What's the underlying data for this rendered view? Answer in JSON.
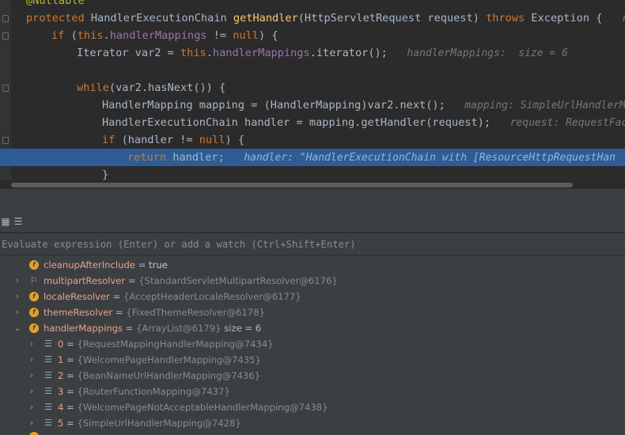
{
  "editor": {
    "lines": [
      {
        "indent": 0,
        "tokens": [
          {
            "t": "@Nullable",
            "c": "tok-anno"
          }
        ]
      },
      {
        "indent": 0,
        "fold": true,
        "tokens": [
          {
            "t": "protected ",
            "c": "tok-kw"
          },
          {
            "t": "HandlerExecutionChain ",
            "c": "tok-plain"
          },
          {
            "t": "getHandler",
            "c": "tok-method"
          },
          {
            "t": "(HttpServletRequest request) ",
            "c": "tok-plain"
          },
          {
            "t": "throws ",
            "c": "tok-kw"
          },
          {
            "t": "Exception {   ",
            "c": "tok-plain"
          },
          {
            "t": "re",
            "c": "hint"
          }
        ]
      },
      {
        "indent": 1,
        "fold": true,
        "tokens": [
          {
            "t": "if ",
            "c": "tok-kw"
          },
          {
            "t": "(",
            "c": "tok-plain"
          },
          {
            "t": "this",
            "c": "tok-kw"
          },
          {
            "t": ".",
            "c": "tok-plain"
          },
          {
            "t": "handlerMappings ",
            "c": "tok-field"
          },
          {
            "t": "!= ",
            "c": "tok-plain"
          },
          {
            "t": "null",
            "c": "tok-kw"
          },
          {
            "t": ") {",
            "c": "tok-plain"
          }
        ]
      },
      {
        "indent": 2,
        "tokens": [
          {
            "t": "Iterator var2 = ",
            "c": "tok-plain"
          },
          {
            "t": "this",
            "c": "tok-kw"
          },
          {
            "t": ".",
            "c": "tok-plain"
          },
          {
            "t": "handlerMappings",
            "c": "tok-field"
          },
          {
            "t": ".iterator();   ",
            "c": "tok-plain"
          },
          {
            "t": "handlerMappings:  size = 6",
            "c": "hint"
          }
        ]
      },
      {
        "indent": 0,
        "tokens": []
      },
      {
        "indent": 2,
        "fold": true,
        "tokens": [
          {
            "t": "while",
            "c": "tok-kw"
          },
          {
            "t": "(var2.hasNext()) {",
            "c": "tok-plain"
          }
        ]
      },
      {
        "indent": 3,
        "tokens": [
          {
            "t": "HandlerMapping mapping = (HandlerMapping)var2.next();   ",
            "c": "tok-plain"
          },
          {
            "t": "mapping: SimpleUrlHandlerM",
            "c": "hint"
          }
        ]
      },
      {
        "indent": 3,
        "tokens": [
          {
            "t": "HandlerExecutionChain handler = mapping.getHandler(request);   ",
            "c": "tok-plain"
          },
          {
            "t": "request: RequestFac",
            "c": "hint"
          }
        ]
      },
      {
        "indent": 3,
        "fold": true,
        "tokens": [
          {
            "t": "if ",
            "c": "tok-kw"
          },
          {
            "t": "(handler != ",
            "c": "tok-plain"
          },
          {
            "t": "null",
            "c": "tok-kw"
          },
          {
            "t": ") {",
            "c": "tok-plain"
          }
        ]
      },
      {
        "indent": 4,
        "active": true,
        "tokens": [
          {
            "t": "return ",
            "c": "tok-kw"
          },
          {
            "t": "handler;   ",
            "c": "tok-plain"
          },
          {
            "t": "handler: \"HandlerExecutionChain with [ResourceHttpRequestHan",
            "c": "hint"
          }
        ]
      },
      {
        "indent": 3,
        "tokens": [
          {
            "t": "}",
            "c": "tok-plain"
          }
        ]
      }
    ]
  },
  "evaluate": {
    "placeholder": "Evaluate expression (Enter) or add a watch (Ctrl+Shift+Enter)"
  },
  "variables": [
    {
      "level": 0,
      "expander": "",
      "icon": "f",
      "name": "cleanupAfterInclude",
      "value": "true",
      "valueBright": true,
      "extra": ""
    },
    {
      "level": 0,
      "expander": "›",
      "icon": "flag",
      "name": "multipartResolver",
      "value": "{StandardServletMultipartResolver@6176}",
      "extra": ""
    },
    {
      "level": 0,
      "expander": "›",
      "icon": "f",
      "name": "localeResolver",
      "value": "{AcceptHeaderLocaleResolver@6177}",
      "extra": ""
    },
    {
      "level": 0,
      "expander": "›",
      "icon": "f",
      "name": "themeResolver",
      "value": "{FixedThemeResolver@6178}",
      "extra": ""
    },
    {
      "level": 0,
      "expander": "⌄",
      "icon": "f",
      "name": "handlerMappings",
      "value": "{ArrayList@6179}",
      "extra": " size = 6"
    },
    {
      "level": 1,
      "expander": "›",
      "icon": "list",
      "name": "0",
      "value": "{RequestMappingHandlerMapping@7434}",
      "extra": ""
    },
    {
      "level": 1,
      "expander": "›",
      "icon": "list",
      "name": "1",
      "value": "{WelcomePageHandlerMapping@7435}",
      "extra": ""
    },
    {
      "level": 1,
      "expander": "›",
      "icon": "list",
      "name": "2",
      "value": "{BeanNameUrlHandlerMapping@7436}",
      "extra": ""
    },
    {
      "level": 1,
      "expander": "›",
      "icon": "list",
      "name": "3",
      "value": "{RouterFunctionMapping@7437}",
      "extra": ""
    },
    {
      "level": 1,
      "expander": "›",
      "icon": "list",
      "name": "4",
      "value": "{WelcomePageNotAcceptableHandlerMapping@7438}",
      "extra": ""
    },
    {
      "level": 1,
      "expander": "›",
      "icon": "list",
      "name": "5",
      "value": "{SimpleUrlHandlerMapping@7428}",
      "extra": ""
    }
  ],
  "colors": {
    "editor_bg": "#2b2b2b",
    "panel_bg": "#3c3f41",
    "active_line": "#2d5d94",
    "keyword": "#cc7832",
    "field": "#9876aa",
    "method": "#ffc66d",
    "field_icon": "#e3a02c"
  },
  "icons": {
    "toolbar": [
      "debug-grid-icon",
      "watch-settings-icon"
    ],
    "variable": "field-icon",
    "list_item": "list-element-icon"
  }
}
